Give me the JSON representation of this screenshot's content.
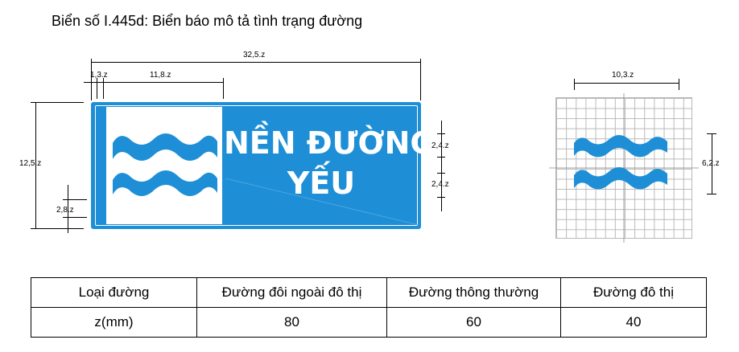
{
  "title": "Biển số I.445d: Biển báo mô tả tình trạng đường",
  "sign": {
    "text_line1": "NỀN ĐƯỜNG",
    "text_line2": "YẾU",
    "background_color": "#1e8fd6"
  },
  "dimensions": {
    "total_width": "32,5.z",
    "left_border": "1,3.z",
    "symbol_width": "11,8.z",
    "total_height": "12,5.z",
    "wave_band": "2,8.z",
    "text_upper": "2,4.z",
    "text_lower": "2,4.z",
    "grid_width": "10,3.z",
    "grid_height": "6,2.z"
  },
  "table": {
    "header": [
      "Loại đường",
      "Đường đôi ngoài đô thị",
      "Đường thông thường",
      "Đường đô thị"
    ],
    "row": [
      "z(mm)",
      "80",
      "60",
      "40"
    ]
  }
}
